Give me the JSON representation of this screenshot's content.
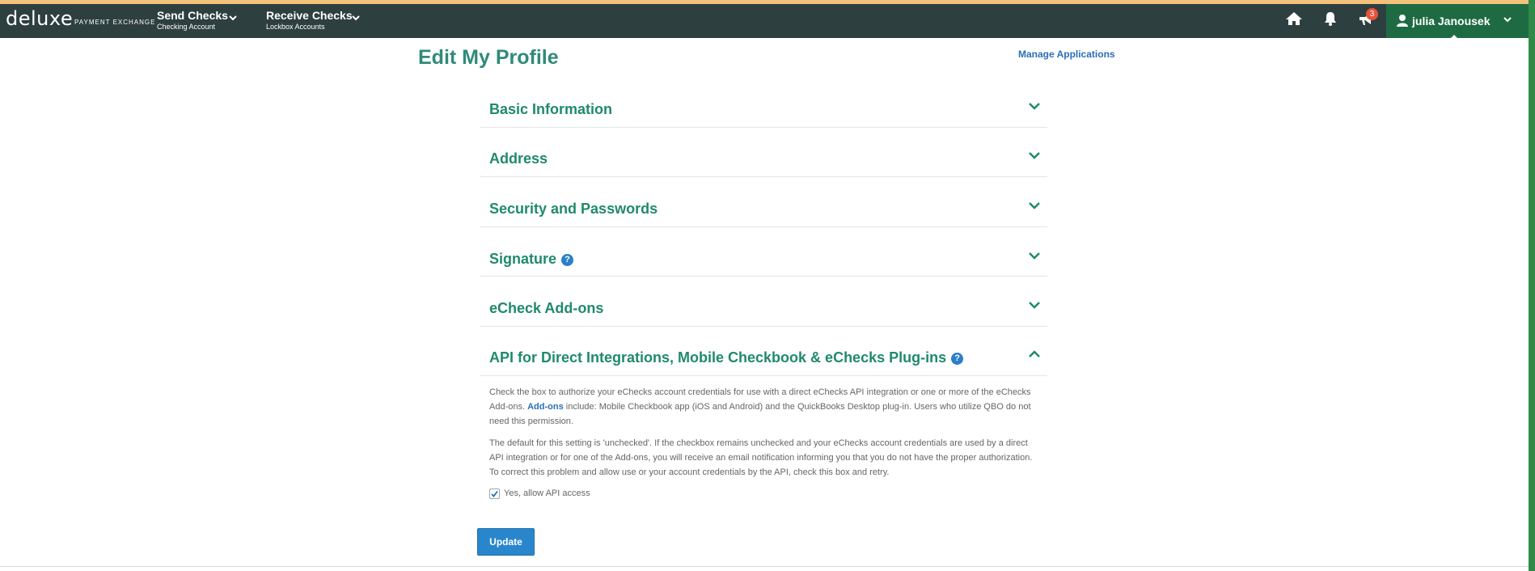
{
  "brand": {
    "logo": "deluxe",
    "sub": "PAYMENT EXCHANGE"
  },
  "nav": {
    "send": {
      "title": "Send Checks",
      "subtitle": "Checking Account"
    },
    "receive": {
      "title": "Receive Checks",
      "subtitle": "Lockbox Accounts"
    },
    "icons": [
      "home-icon",
      "bell-icon",
      "megaphone-icon"
    ],
    "notification_count": "3",
    "user": "julia Janousek"
  },
  "page": {
    "title": "Edit My Profile",
    "manage_link": "Manage Applications"
  },
  "sections": [
    {
      "title": "Basic Information",
      "expanded": false
    },
    {
      "title": "Address",
      "expanded": false
    },
    {
      "title": "Security and Passwords",
      "expanded": false
    },
    {
      "title": "Signature",
      "expanded": false,
      "help": true
    },
    {
      "title": "eCheck Add-ons",
      "expanded": false
    },
    {
      "title": "API for Direct Integrations, Mobile Checkbook & eChecks Plug-ins",
      "expanded": true,
      "help": true
    }
  ],
  "api_section": {
    "para1_pre": "Check the box to authorize your eChecks account credentials for use with a direct eChecks API integration or one or more of the eChecks Add-ons.",
    "para1_link": "Add-ons",
    "para1_post": "include: Mobile Checkbook app (iOS and Android) and the QuickBooks Desktop plug-in. Users who utilize QBO do not need this permission.",
    "para2": "The default for this setting is 'unchecked'. If the checkbox remains unchecked and your eChecks account credentials are used by a direct API integration or for one of the Add-ons, you will receive an email notification informing you that you do not have the proper authorization. To correct this problem and allow use or your account credentials by the API, check this box and retry.",
    "checkbox_label": "Yes, allow API access",
    "checkbox_checked": true
  },
  "update_button": "Update",
  "colors": {
    "nav_bg": "#2e3f3f",
    "accent_green": "#1f8a6c",
    "link_blue": "#2a6fb5",
    "button_blue": "#2a86cc",
    "badge": "#e8533a"
  }
}
